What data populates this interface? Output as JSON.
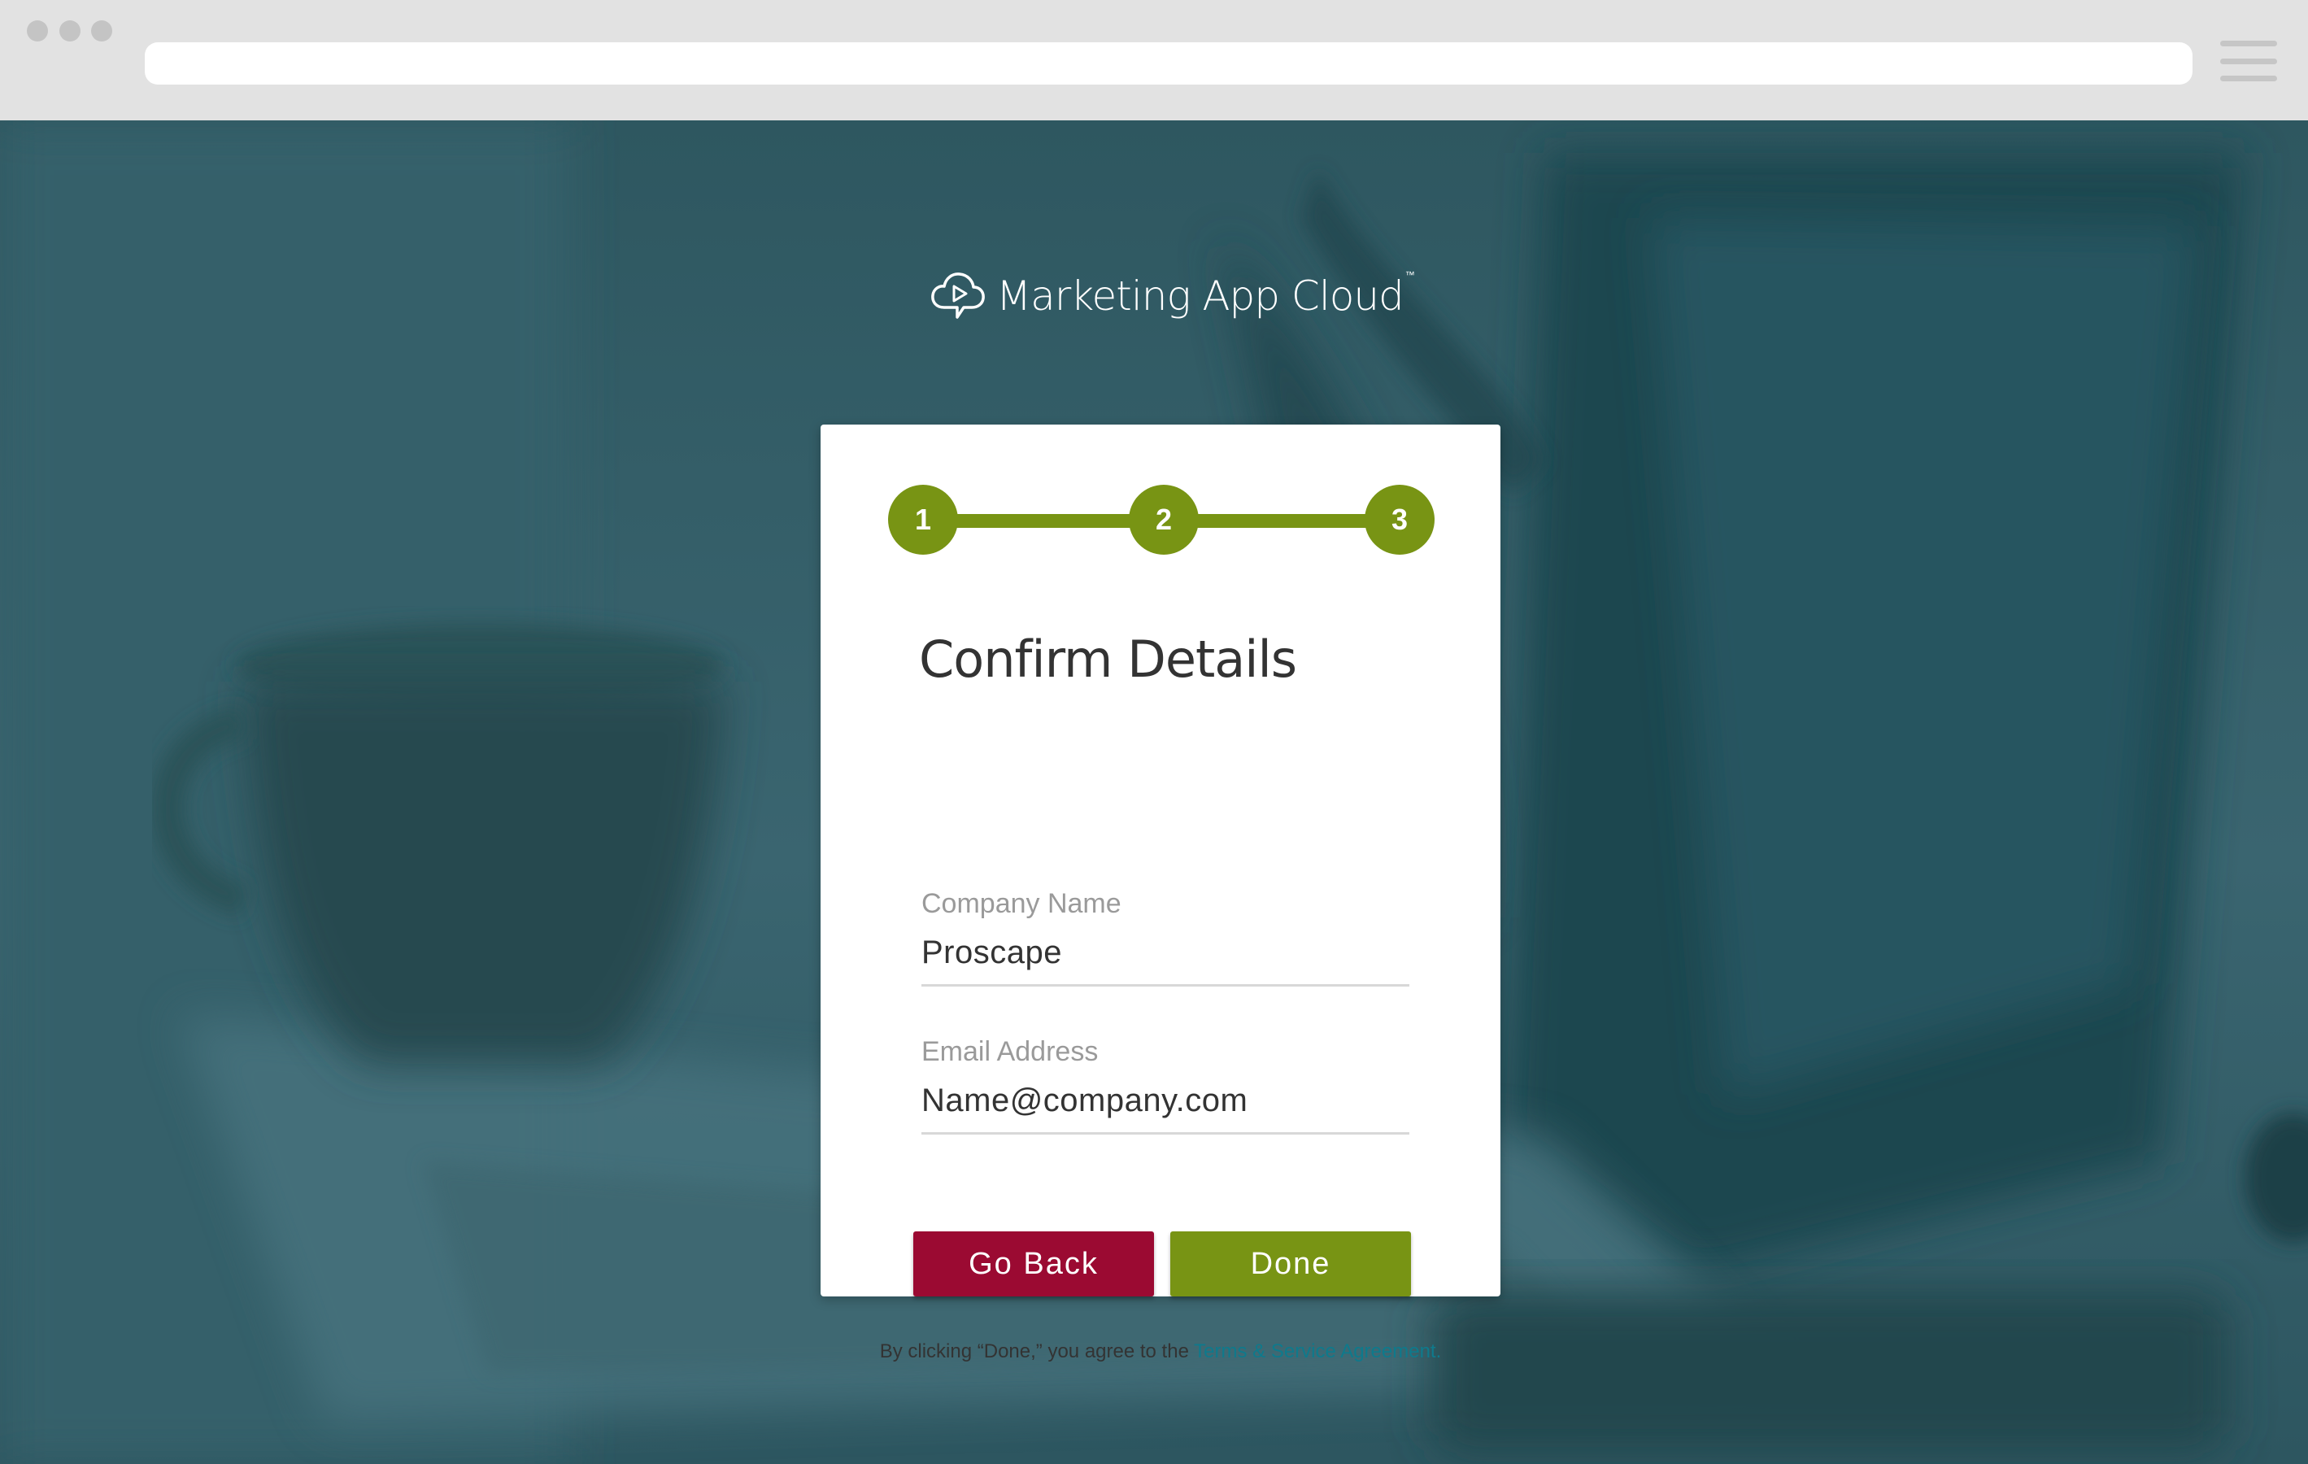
{
  "browser": {
    "url": ""
  },
  "app": {
    "logo_name": "Marketing App Cloud",
    "logo_tm": "™"
  },
  "stepper": {
    "steps": [
      "1",
      "2",
      "3"
    ],
    "active_color": "#789414"
  },
  "form": {
    "title": "Confirm Details",
    "company": {
      "label": "Company Name",
      "value": "Proscape"
    },
    "email": {
      "label": "Email Address",
      "value": "Name@company.com"
    }
  },
  "buttons": {
    "back_label": "Go Back",
    "done_label": "Done",
    "back_color": "#9b0a32",
    "done_color": "#789414"
  },
  "terms": {
    "prefix": "By clicking “Done,” you agree to the",
    "link_text": "Terms & Service Agreement."
  },
  "icons": {
    "logo": "cloud-play-icon",
    "menu": "hamburger-menu-icon"
  },
  "colors": {
    "background_overlay": "#2f5862",
    "link": "#0e7a8c"
  }
}
